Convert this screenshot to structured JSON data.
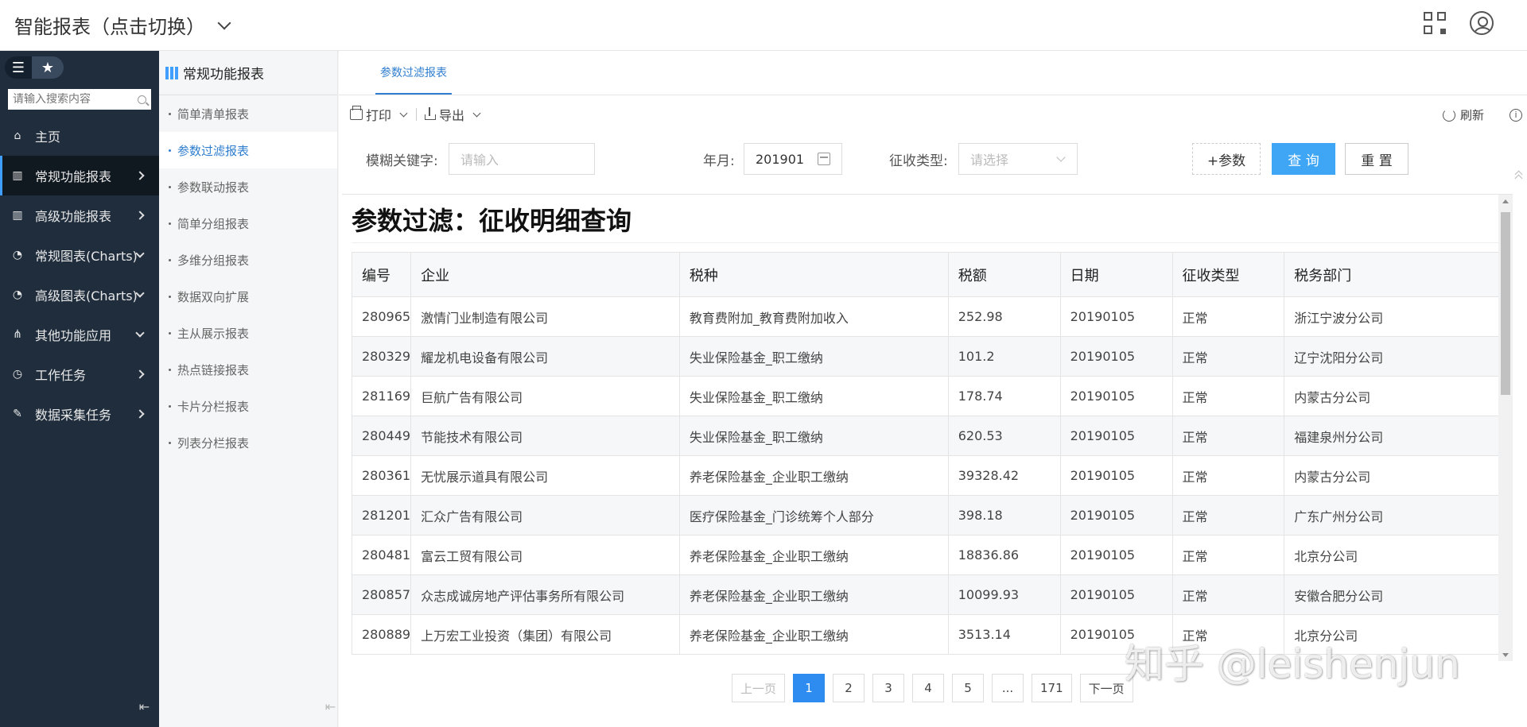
{
  "header": {
    "title": "智能报表（点击切换）"
  },
  "sidebar": {
    "search_placeholder": "请输入搜索内容",
    "items": [
      {
        "label": "主页",
        "icon": "home-icon",
        "chevron": ""
      },
      {
        "label": "常规功能报表",
        "icon": "report-icon",
        "chevron": "right",
        "active": true
      },
      {
        "label": "高级功能报表",
        "icon": "report-icon",
        "chevron": "right"
      },
      {
        "label": "常规图表(Charts)",
        "icon": "chart-icon",
        "chevron": "down"
      },
      {
        "label": "高级图表(Charts)",
        "icon": "chart-icon",
        "chevron": "down"
      },
      {
        "label": "其他功能应用",
        "icon": "sitemap-icon",
        "chevron": "down"
      },
      {
        "label": "工作任务",
        "icon": "clock-icon",
        "chevron": "right"
      },
      {
        "label": "数据采集任务",
        "icon": "edit-icon",
        "chevron": "right"
      }
    ]
  },
  "submenu": {
    "title": "常规功能报表",
    "items": [
      "简单清单报表",
      "参数过滤报表",
      "参数联动报表",
      "简单分组报表",
      "多维分组报表",
      "数据双向扩展",
      "主从展示报表",
      "热点链接报表",
      "卡片分栏报表",
      "列表分栏报表"
    ],
    "active_index": 1
  },
  "tabs": [
    "参数过滤报表"
  ],
  "toolbar": {
    "print": "打印",
    "export": "导出",
    "refresh": "刷新"
  },
  "filters": {
    "keyword_label": "模糊关键字:",
    "keyword_placeholder": "请输入",
    "month_label": "年月:",
    "month_value": "201901",
    "type_label": "征收类型:",
    "type_placeholder": "请选择",
    "param_button": "+参数",
    "query_button": "查 询",
    "reset_button": "重 置"
  },
  "report": {
    "title": "参数过滤：征收明细查询",
    "columns": [
      "编号",
      "企业",
      "税种",
      "税额",
      "日期",
      "征收类型",
      "税务部门"
    ],
    "rows": [
      [
        "280965",
        "激情门业制造有限公司",
        "教育费附加_教育费附加收入",
        "252.98",
        "20190105",
        "正常",
        "浙江宁波分公司"
      ],
      [
        "280329",
        "耀龙机电设备有限公司",
        "失业保险基金_职工缴纳",
        "101.2",
        "20190105",
        "正常",
        "辽宁沈阳分公司"
      ],
      [
        "281169",
        "巨航广告有限公司",
        "失业保险基金_职工缴纳",
        "178.74",
        "20190105",
        "正常",
        "内蒙古分公司"
      ],
      [
        "280449",
        "节能技术有限公司",
        "失业保险基金_职工缴纳",
        "620.53",
        "20190105",
        "正常",
        "福建泉州分公司"
      ],
      [
        "280361",
        "无忧展示道具有限公司",
        "养老保险基金_企业职工缴纳",
        "39328.42",
        "20190105",
        "正常",
        "内蒙古分公司"
      ],
      [
        "281201",
        "汇众广告有限公司",
        "医疗保险基金_门诊统筹个人部分",
        "398.18",
        "20190105",
        "正常",
        "广东广州分公司"
      ],
      [
        "280481",
        "富云工贸有限公司",
        "养老保险基金_企业职工缴纳",
        "18836.86",
        "20190105",
        "正常",
        "北京分公司"
      ],
      [
        "280857",
        "众志成诚房地产评估事务所有限公司",
        "养老保险基金_企业职工缴纳",
        "10099.93",
        "20190105",
        "正常",
        "安徽合肥分公司"
      ],
      [
        "280889",
        "上万宏工业投资（集团）有限公司",
        "养老保险基金_企业职工缴纳",
        "3513.14",
        "20190105",
        "正常",
        "北京分公司"
      ]
    ]
  },
  "pager": {
    "prev": "上一页",
    "pages": [
      "1",
      "2",
      "3",
      "4",
      "5",
      "...",
      "171"
    ],
    "current": "1",
    "next": "下一页"
  },
  "watermark": "知乎 @leishenjun"
}
